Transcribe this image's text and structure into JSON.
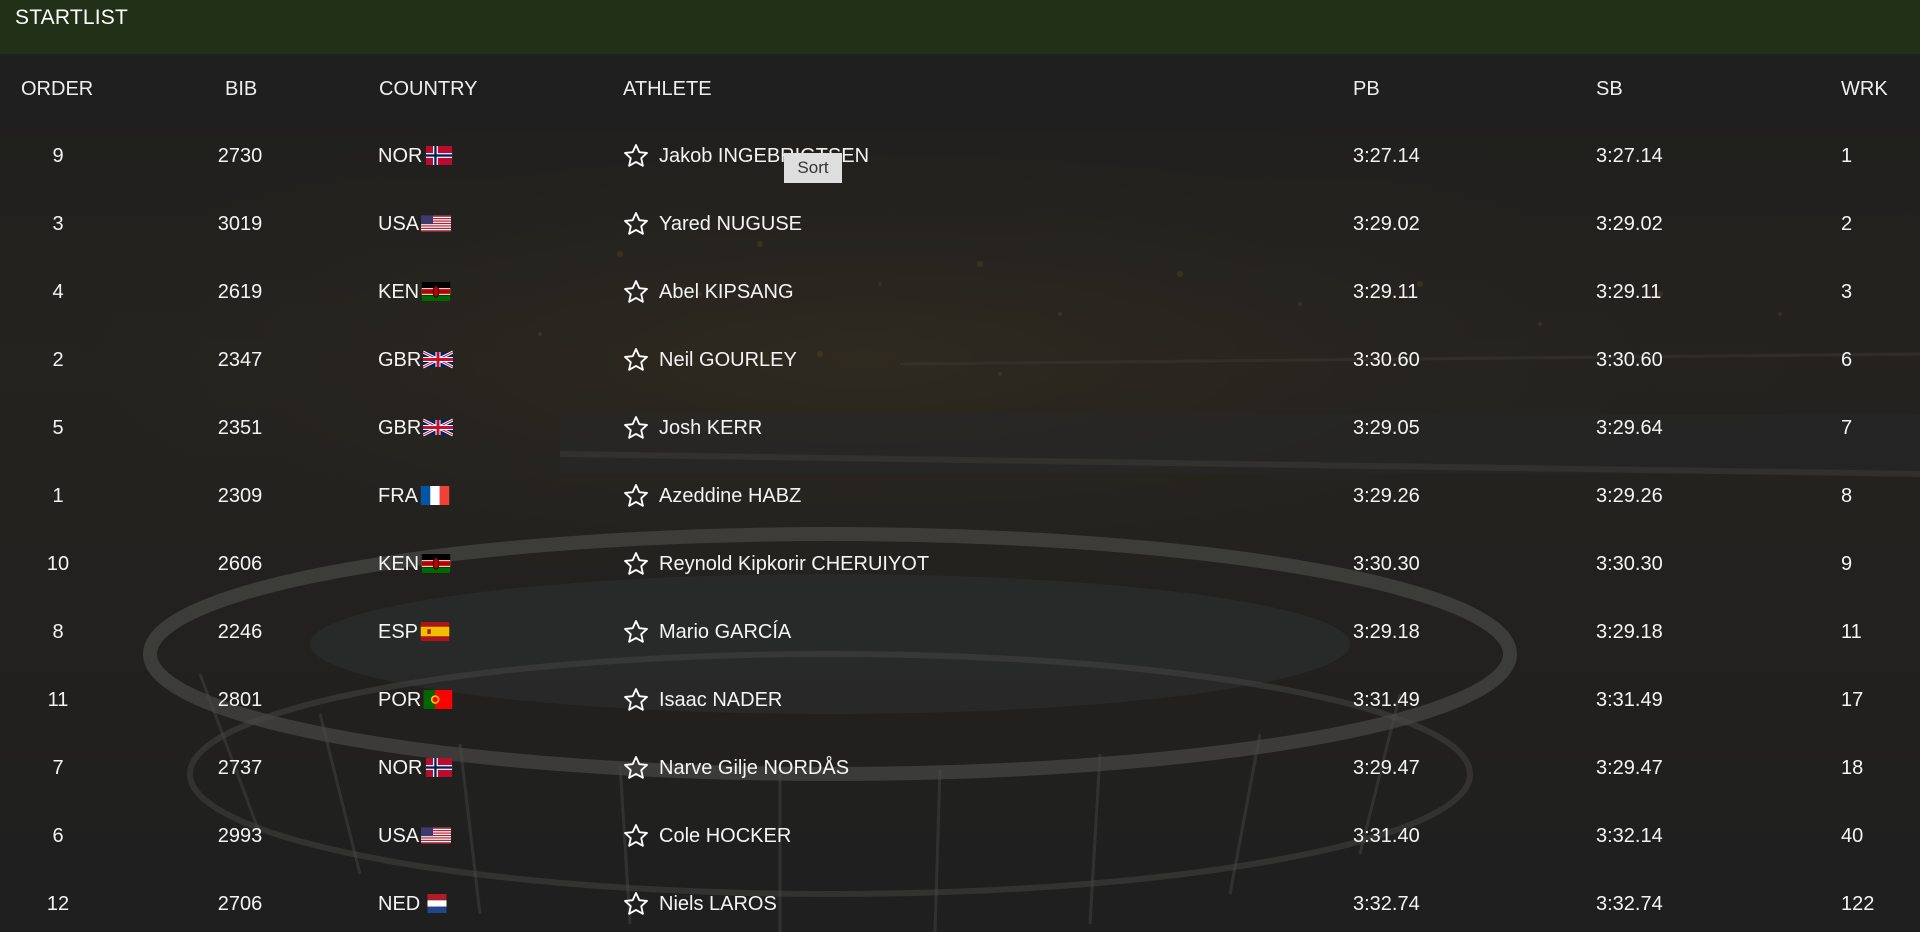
{
  "title": "STARTLIST",
  "columns": {
    "order": "ORDER",
    "bib": "BIB",
    "country": "COUNTRY",
    "athlete": "ATHLETE",
    "pb": "PB",
    "sb": "SB",
    "wrk": "WRK"
  },
  "tooltip": "Sort",
  "rows": [
    {
      "order": "9",
      "bib": "2730",
      "country": "NOR",
      "flag": "nor",
      "athlete": "Jakob INGEBRIGTSEN",
      "pb": "3:27.14",
      "sb": "3:27.14",
      "wrk": "1"
    },
    {
      "order": "3",
      "bib": "3019",
      "country": "USA",
      "flag": "usa",
      "athlete": "Yared NUGUSE",
      "pb": "3:29.02",
      "sb": "3:29.02",
      "wrk": "2"
    },
    {
      "order": "4",
      "bib": "2619",
      "country": "KEN",
      "flag": "ken",
      "athlete": "Abel KIPSANG",
      "pb": "3:29.11",
      "sb": "3:29.11",
      "wrk": "3"
    },
    {
      "order": "2",
      "bib": "2347",
      "country": "GBR",
      "flag": "gbr",
      "athlete": "Neil GOURLEY",
      "pb": "3:30.60",
      "sb": "3:30.60",
      "wrk": "6"
    },
    {
      "order": "5",
      "bib": "2351",
      "country": "GBR",
      "flag": "gbr",
      "athlete": "Josh KERR",
      "pb": "3:29.05",
      "sb": "3:29.64",
      "wrk": "7"
    },
    {
      "order": "1",
      "bib": "2309",
      "country": "FRA",
      "flag": "fra",
      "athlete": "Azeddine HABZ",
      "pb": "3:29.26",
      "sb": "3:29.26",
      "wrk": "8"
    },
    {
      "order": "10",
      "bib": "2606",
      "country": "KEN",
      "flag": "ken",
      "athlete": "Reynold Kipkorir CHERUIYOT",
      "pb": "3:30.30",
      "sb": "3:30.30",
      "wrk": "9"
    },
    {
      "order": "8",
      "bib": "2246",
      "country": "ESP",
      "flag": "esp",
      "athlete": "Mario GARCÍA",
      "pb": "3:29.18",
      "sb": "3:29.18",
      "wrk": "11"
    },
    {
      "order": "11",
      "bib": "2801",
      "country": "POR",
      "flag": "por",
      "athlete": "Isaac NADER",
      "pb": "3:31.49",
      "sb": "3:31.49",
      "wrk": "17"
    },
    {
      "order": "7",
      "bib": "2737",
      "country": "NOR",
      "flag": "nor",
      "athlete": "Narve Gilje NORDÅS",
      "pb": "3:29.47",
      "sb": "3:29.47",
      "wrk": "18"
    },
    {
      "order": "6",
      "bib": "2993",
      "country": "USA",
      "flag": "usa",
      "athlete": "Cole HOCKER",
      "pb": "3:31.40",
      "sb": "3:32.14",
      "wrk": "40"
    },
    {
      "order": "12",
      "bib": "2706",
      "country": "NED",
      "flag": "ned",
      "athlete": "Niels LAROS",
      "pb": "3:32.74",
      "sb": "3:32.74",
      "wrk": "122"
    }
  ],
  "colors": {
    "titlebar": "#223018",
    "background": "#1c1c1c",
    "text": "#f4f4f4"
  }
}
